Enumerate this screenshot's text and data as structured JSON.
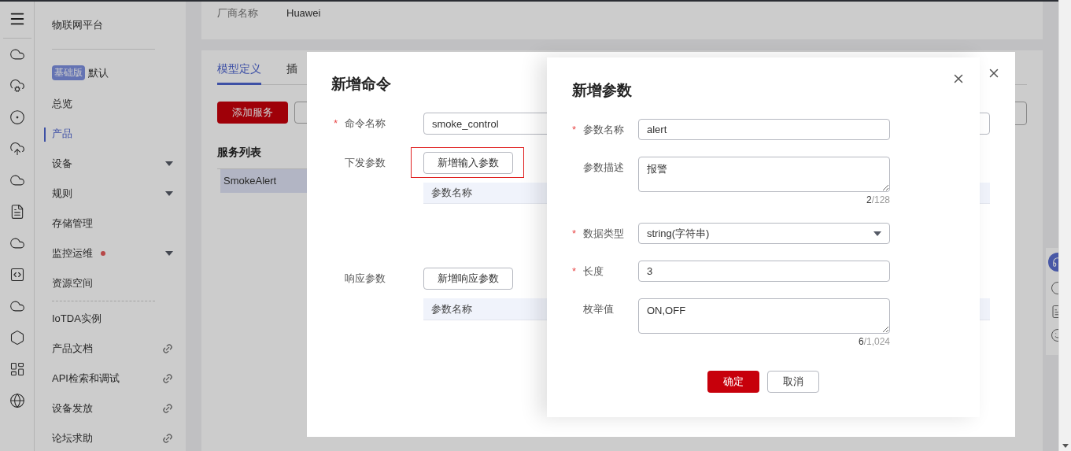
{
  "required_mark": "*",
  "sidebar": {
    "title": "物联网平台",
    "edition_badge": "基础版",
    "edition": "默认",
    "items": [
      {
        "label": "总览",
        "kind": "page",
        "selected": false,
        "notice": false
      },
      {
        "label": "产品",
        "kind": "page",
        "selected": true,
        "notice": false
      },
      {
        "label": "设备",
        "kind": "group",
        "selected": false,
        "notice": false
      },
      {
        "label": "规则",
        "kind": "group",
        "selected": false,
        "notice": false
      },
      {
        "label": "存储管理",
        "kind": "page",
        "selected": false,
        "notice": false
      },
      {
        "label": "监控运维",
        "kind": "group",
        "selected": false,
        "notice": true
      },
      {
        "label": "资源空间",
        "kind": "page",
        "selected": false,
        "notice": false
      }
    ],
    "links": [
      {
        "label": "IoTDA实例",
        "kind": "page",
        "selected": false,
        "notice": false
      },
      {
        "label": "产品文档",
        "kind": "external",
        "selected": false,
        "notice": false
      },
      {
        "label": "API检索和调试",
        "kind": "external",
        "selected": false,
        "notice": false
      },
      {
        "label": "设备发放",
        "kind": "external",
        "selected": false,
        "notice": false
      },
      {
        "label": "论坛求助",
        "kind": "external",
        "selected": false,
        "notice": false
      }
    ]
  },
  "vendor": {
    "label": "厂商名称",
    "value": "Huawei"
  },
  "model_tabs": [
    {
      "label": "模型定义",
      "selected": true
    },
    {
      "label": "插",
      "selected": false
    }
  ],
  "add_service_button": "添加服务",
  "service_list": {
    "title": "服务列表",
    "items": [
      {
        "label": "SmokeAlert",
        "selected": true
      }
    ]
  },
  "command_dialog": {
    "title": "新增命令",
    "name_label": "命令名称",
    "name_required": true,
    "name_value": "smoke_control",
    "input_params_label": "下发参数",
    "add_input_button": {
      "label": "新增输入参数",
      "highlighted": true
    },
    "input_table_columns": [
      "参数名称"
    ],
    "response_params_label": "响应参数",
    "add_response_button": {
      "label": "新增响应参数",
      "highlighted": false
    },
    "response_table_columns": [
      "参数名称"
    ]
  },
  "param_dialog": {
    "title": "新增参数",
    "fields": [
      {
        "kind": "input",
        "label": "参数名称",
        "required": true,
        "value": "alert"
      },
      {
        "kind": "textarea",
        "label": "参数描述",
        "required": false,
        "value": "报警",
        "count": "2",
        "limit": "/128"
      },
      {
        "kind": "select",
        "label": "数据类型",
        "required": true,
        "value": "string(字符串)"
      },
      {
        "kind": "input",
        "label": "长度",
        "required": true,
        "value": "3"
      },
      {
        "kind": "textarea",
        "label": "枚举值",
        "required": false,
        "value": "ON,OFF",
        "count": "6",
        "limit": "/1,024"
      }
    ],
    "buttons": [
      {
        "label": "确定",
        "primary": true
      },
      {
        "label": "取消",
        "primary": false
      }
    ]
  }
}
